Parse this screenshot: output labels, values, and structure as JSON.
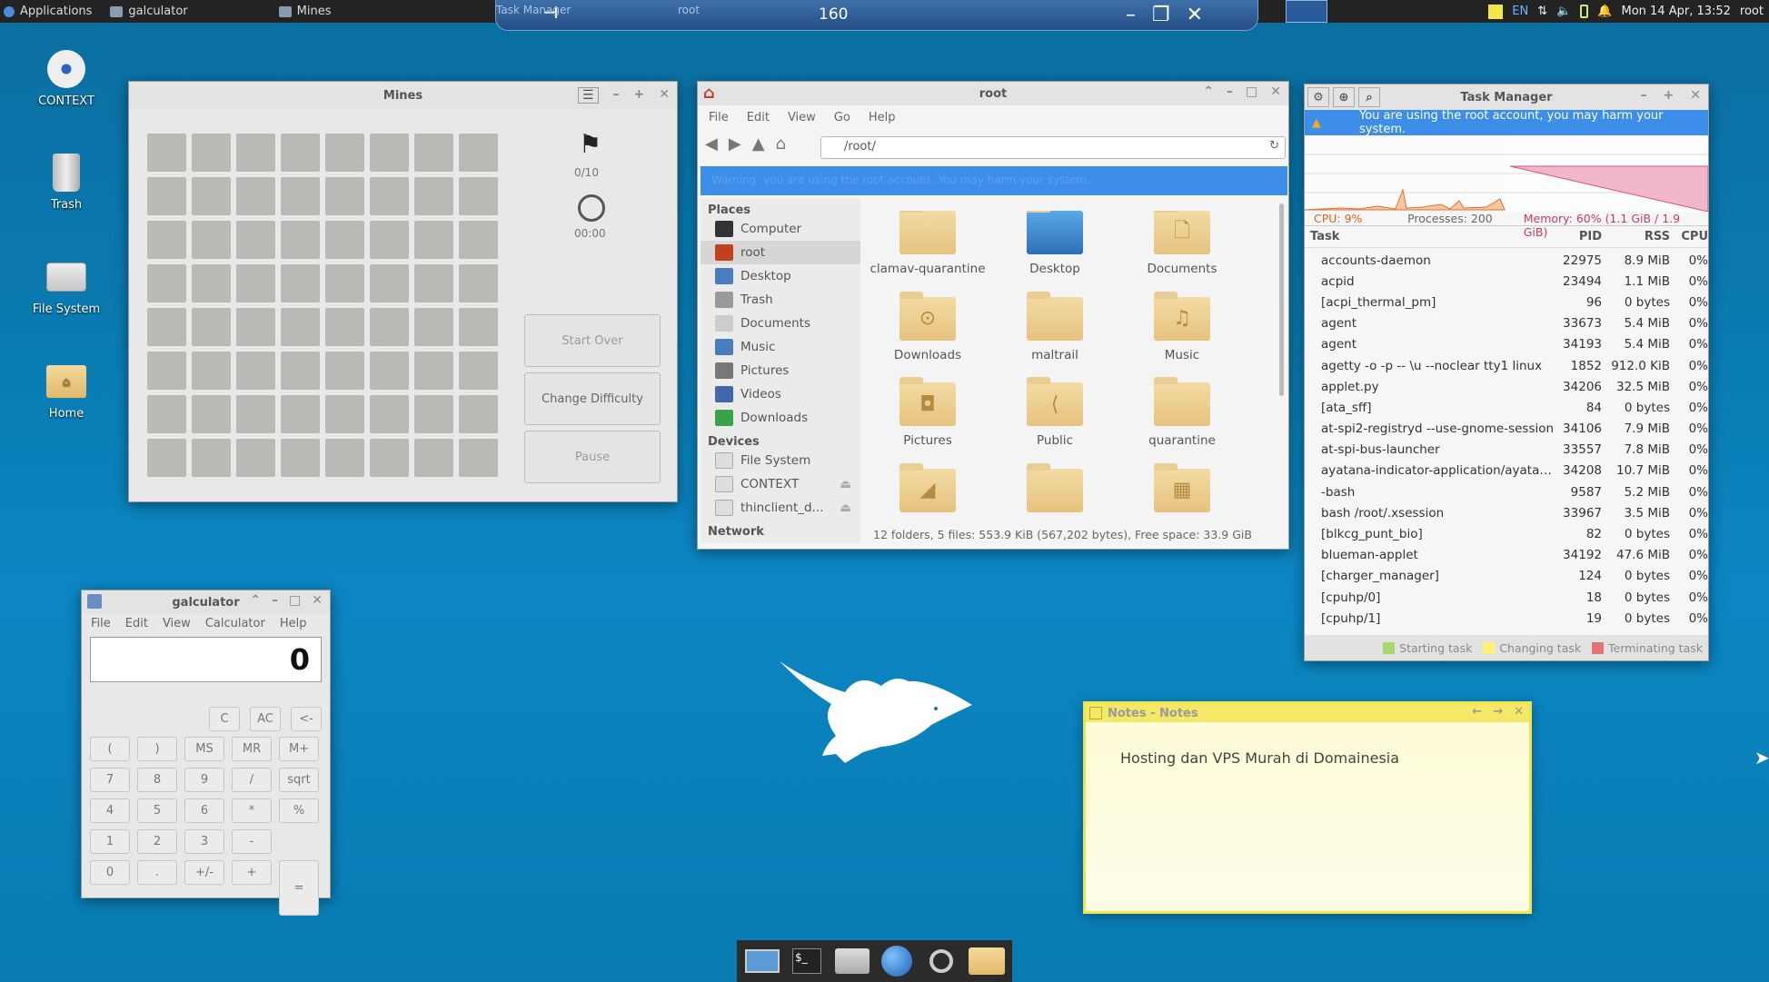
{
  "panel": {
    "applications": "Applications",
    "tasks": [
      {
        "label": "galculator"
      },
      {
        "label": "Mines"
      },
      {
        "label": "Task Manager"
      },
      {
        "label": "root"
      }
    ],
    "remote_number": "160",
    "lang": "EN",
    "datetime": "Mon 14 Apr, 13:52",
    "user": "root"
  },
  "desktop_icons": [
    {
      "label": "CONTEXT",
      "icon": "disc-icon"
    },
    {
      "label": "Trash",
      "icon": "trash-icon"
    },
    {
      "label": "File System",
      "icon": "drive-icon"
    },
    {
      "label": "Home",
      "icon": "home-folder-icon"
    }
  ],
  "mines": {
    "title": "Mines",
    "flags": "0/10",
    "time": "00:00",
    "buttons": {
      "start_over": "Start Over",
      "change_difficulty": "Change Difficulty",
      "pause": "Pause"
    }
  },
  "filemanager": {
    "title": "root",
    "menu": [
      "File",
      "Edit",
      "View",
      "Go",
      "Help"
    ],
    "path": "/root/",
    "warning": "Warning: you are using the root account. You may harm your system.",
    "places_header": "Places",
    "places": [
      "Computer",
      "root",
      "Desktop",
      "Trash",
      "Documents",
      "Music",
      "Pictures",
      "Videos",
      "Downloads"
    ],
    "devices_header": "Devices",
    "devices": [
      "File System",
      "CONTEXT",
      "thinclient_d..."
    ],
    "network_header": "Network",
    "folders": [
      {
        "label": "clamav-quarantine",
        "glyph": ""
      },
      {
        "label": "Desktop",
        "glyph": ""
      },
      {
        "label": "Documents",
        "glyph": "🗋"
      },
      {
        "label": "Downloads",
        "glyph": "⊙"
      },
      {
        "label": "maltrail",
        "glyph": ""
      },
      {
        "label": "Music",
        "glyph": "♫"
      },
      {
        "label": "Pictures",
        "glyph": "◘"
      },
      {
        "label": "Public",
        "glyph": "⟨"
      },
      {
        "label": "quarantine",
        "glyph": ""
      },
      {
        "label": "",
        "glyph": "◢"
      },
      {
        "label": "",
        "glyph": ""
      },
      {
        "label": "",
        "glyph": "▦"
      }
    ],
    "status": "12 folders, 5 files: 553.9 KiB (567,202 bytes), Free space: 33.9 GiB"
  },
  "taskmanager": {
    "title": "Task Manager",
    "warning": "You are using the root account, you may harm your system.",
    "cpu": "CPU: 9%",
    "processes": "Processes: 200",
    "memory": "Memory: 60% (1.1 GiB / 1.9 GiB)",
    "headers": {
      "task": "Task",
      "pid": "PID",
      "rss": "RSS",
      "cpu": "CPU"
    },
    "rows": [
      [
        "accounts-daemon",
        "22975",
        "8.9 MiB",
        "0%"
      ],
      [
        "acpid",
        "23494",
        "1.1 MiB",
        "0%"
      ],
      [
        "[acpi_thermal_pm]",
        "96",
        "0 bytes",
        "0%"
      ],
      [
        "agent",
        "33673",
        "5.4 MiB",
        "0%"
      ],
      [
        "agent",
        "34193",
        "5.4 MiB",
        "0%"
      ],
      [
        "agetty -o -p -- \\u --noclear tty1 linux",
        "1852",
        "912.0 KiB",
        "0%"
      ],
      [
        "applet.py",
        "34206",
        "32.5 MiB",
        "0%"
      ],
      [
        "[ata_sff]",
        "84",
        "0 bytes",
        "0%"
      ],
      [
        "at-spi2-registryd --use-gnome-session",
        "34106",
        "7.9 MiB",
        "0%"
      ],
      [
        "at-spi-bus-launcher",
        "33557",
        "7.8 MiB",
        "0%"
      ],
      [
        "ayatana-indicator-application/ayatan...",
        "34208",
        "10.7 MiB",
        "0%"
      ],
      [
        "-bash",
        "9587",
        "5.2 MiB",
        "0%"
      ],
      [
        "bash /root/.xsession",
        "33967",
        "3.5 MiB",
        "0%"
      ],
      [
        "[blkcg_punt_bio]",
        "82",
        "0 bytes",
        "0%"
      ],
      [
        "blueman-applet",
        "34192",
        "47.6 MiB",
        "0%"
      ],
      [
        "[charger_manager]",
        "124",
        "0 bytes",
        "0%"
      ],
      [
        "[cpuhp/0]",
        "18",
        "0 bytes",
        "0%"
      ],
      [
        "[cpuhp/1]",
        "19",
        "0 bytes",
        "0%"
      ]
    ],
    "legend": {
      "starting": "Starting task",
      "changing": "Changing task",
      "terminating": "Terminating task"
    },
    "colors": {
      "starting": "#a6d96a",
      "changing": "#fff176",
      "terminating": "#e57373"
    }
  },
  "calculator": {
    "title": "galculator",
    "menu": [
      "File",
      "Edit",
      "View",
      "Calculator",
      "Help"
    ],
    "display": "0",
    "keys_top": [
      "C",
      "AC",
      "<-"
    ],
    "keys_mem": [
      "(",
      ")",
      "MS",
      "MR",
      "M+"
    ],
    "keys": [
      [
        "7",
        "8",
        "9",
        "/",
        "sqrt"
      ],
      [
        "4",
        "5",
        "6",
        "*",
        "%"
      ],
      [
        "1",
        "2",
        "3",
        "-"
      ],
      [
        "0",
        ".",
        "+/-",
        "+"
      ]
    ],
    "equals": "="
  },
  "notes": {
    "title": "Notes - Notes",
    "text": "Hosting dan VPS Murah di Domainesia"
  },
  "colors": {
    "accent": "#3c8ee8",
    "desktop": "#0a7bb3"
  }
}
